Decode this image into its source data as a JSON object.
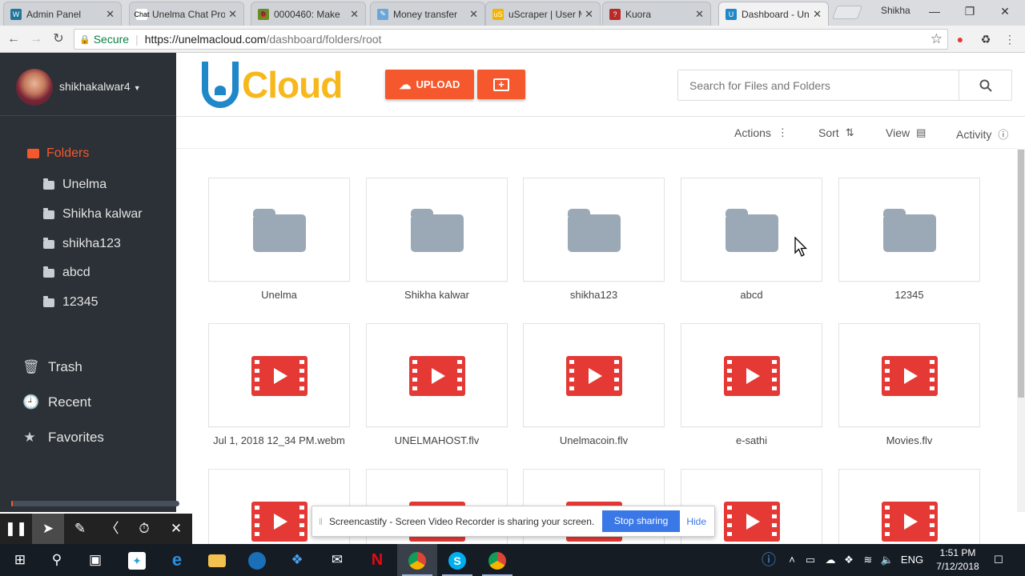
{
  "browser": {
    "tabs": [
      {
        "title": "Admin Panel",
        "favicon": "wordpress-icon",
        "color": "#21759b",
        "glyph": "W",
        "active": false
      },
      {
        "title": "Unelma Chat Pro",
        "favicon": "chat-icon",
        "color": "#ffffff",
        "glyph": "Chat",
        "active": false
      },
      {
        "title": "0000460: Make",
        "favicon": "bug-icon",
        "color": "#6b8e23",
        "glyph": "🐞",
        "active": false
      },
      {
        "title": "Money transfer",
        "favicon": "feather-icon",
        "color": "#6aa7d8",
        "glyph": "✎",
        "active": false
      },
      {
        "title": "uScraper | User M",
        "favicon": "uscraper-icon",
        "color": "#f3b400",
        "glyph": "uS",
        "active": false
      },
      {
        "title": "Kuora",
        "favicon": "kuora-icon",
        "color": "#b92b27",
        "glyph": "?",
        "active": false
      },
      {
        "title": "Dashboard - Unelma",
        "favicon": "ucloud-icon",
        "color": "#1e88c8",
        "glyph": "U",
        "active": true
      }
    ],
    "profile_name": "Shikha",
    "secure_label": "Secure",
    "url_host": "https://unelmacloud.com",
    "url_path": "/dashboard/folders/root"
  },
  "sidebar": {
    "username": "shikhakalwar4",
    "folders_label": "Folders",
    "subfolders": [
      "Unelma",
      "Shikha kalwar",
      "shikha123",
      "abcd",
      "12345"
    ],
    "nav": [
      {
        "label": "Trash",
        "icon": "trash-icon",
        "glyph": "🗑"
      },
      {
        "label": "Recent",
        "icon": "clock-icon",
        "glyph": "🕘"
      },
      {
        "label": "Favorites",
        "icon": "star-icon",
        "glyph": "★"
      }
    ],
    "storage_used_fraction": 0.01
  },
  "header": {
    "logo_text": "Cloud",
    "upload_label": "UPLOAD",
    "search_placeholder": "Search for Files and Folders"
  },
  "toolbar": {
    "actions_label": "Actions",
    "sort_label": "Sort",
    "view_label": "View",
    "activity_label": "Activity"
  },
  "items": [
    {
      "name": "Unelma",
      "type": "folder"
    },
    {
      "name": "Shikha kalwar",
      "type": "folder"
    },
    {
      "name": "shikha123",
      "type": "folder"
    },
    {
      "name": "abcd",
      "type": "folder"
    },
    {
      "name": "12345",
      "type": "folder"
    },
    {
      "name": "Jul 1, 2018 12_34 PM.webm",
      "type": "video"
    },
    {
      "name": "UNELMAHOST.flv",
      "type": "video"
    },
    {
      "name": "Unelmacoin.flv",
      "type": "video"
    },
    {
      "name": "e-sathi",
      "type": "video"
    },
    {
      "name": "Movies.flv",
      "type": "video"
    },
    {
      "name": "",
      "type": "video"
    },
    {
      "name": "",
      "type": "video"
    },
    {
      "name": "",
      "type": "video"
    },
    {
      "name": "",
      "type": "video"
    },
    {
      "name": "",
      "type": "video"
    }
  ],
  "screencastify": {
    "message": "Screencastify - Screen Video Recorder is sharing your screen.",
    "stop_label": "Stop sharing",
    "hide_label": "Hide"
  },
  "taskbar": {
    "language": "ENG",
    "time": "1:51 PM",
    "date": "7/12/2018"
  },
  "colors": {
    "accent": "#f5582d",
    "sidebar_bg": "#2b3136",
    "video_red": "#e53935",
    "folder_grey": "#9aa9b5"
  }
}
